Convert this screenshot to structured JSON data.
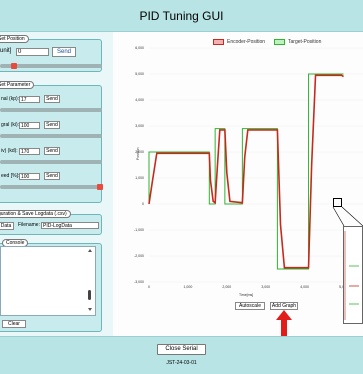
{
  "header": {
    "title": "PID Tuning GUI"
  },
  "set_position": {
    "legend": "Set Position",
    "label": "unit] ",
    "value": "0",
    "send_label": "Send"
  },
  "set_parameter": {
    "legend": "Set Parameter",
    "rows": [
      {
        "label": "nal (kp):",
        "value": "17",
        "send": "Send"
      },
      {
        "label": "gral (ki):",
        "value": "100",
        "send": "Send"
      },
      {
        "label": "iv) (kd):",
        "value": "170",
        "send": "Send"
      },
      {
        "label": "eed [%]:",
        "value": "100",
        "send": "Send"
      }
    ],
    "slider_levels": [
      0.0,
      0.0,
      0.0,
      1.0
    ]
  },
  "config": {
    "legend": "guration & Save Logdata (.csv)",
    "data_button": "Data",
    "filename_label": "Filename:",
    "filename_value": "PID-LogData"
  },
  "console": {
    "legend": "Console",
    "clear_label": "Clear"
  },
  "plot": {
    "legend_encoder": "Encoder-Position",
    "legend_target": "Target-Position",
    "ylabel": "Position",
    "xlabel": "Time[ms]",
    "autoscale_label": "Autoscale",
    "add_graph_label": "Add Graph",
    "encoder_color": "#c62a1f",
    "target_color": "#2fb52f",
    "arrow_color": "#e21b1b"
  },
  "chart_data": {
    "type": "line",
    "xlabel": "Time[ms]",
    "ylabel": "Position",
    "xlim": [
      0,
      5500
    ],
    "ylim": [
      -3000,
      6000
    ],
    "x_ticks": [
      "0",
      "1,000",
      "2,000",
      "3,000",
      "4,000",
      "5,000"
    ],
    "y_ticks": [
      "6,000",
      "5,000",
      "4,000",
      "3,000",
      "2,000",
      "1,000",
      "0",
      "-1,000",
      "-2,000",
      "-3,000"
    ],
    "series": [
      {
        "name": "Target-Position",
        "x": [
          0,
          0,
          1550,
          1550,
          1700,
          1700,
          1950,
          1950,
          2400,
          2400,
          3300,
          3300,
          4100,
          4100,
          5000
        ],
        "y": [
          0,
          2000,
          2000,
          0,
          0,
          2900,
          2900,
          0,
          0,
          2900,
          2900,
          -2500,
          -2500,
          5000,
          5000
        ]
      },
      {
        "name": "Encoder-Position",
        "x": [
          0,
          80,
          200,
          1550,
          1580,
          1650,
          1700,
          1760,
          1820,
          1950,
          2000,
          2080,
          2400,
          2460,
          2540,
          3300,
          3380,
          3480,
          4100,
          4180,
          4280,
          4950,
          5000
        ],
        "y": [
          0,
          800,
          1950,
          1950,
          900,
          100,
          50,
          1500,
          2850,
          2850,
          1200,
          100,
          50,
          1800,
          2850,
          2850,
          -800,
          -2450,
          -2450,
          1500,
          4950,
          4950,
          4900
        ]
      }
    ]
  }
}
